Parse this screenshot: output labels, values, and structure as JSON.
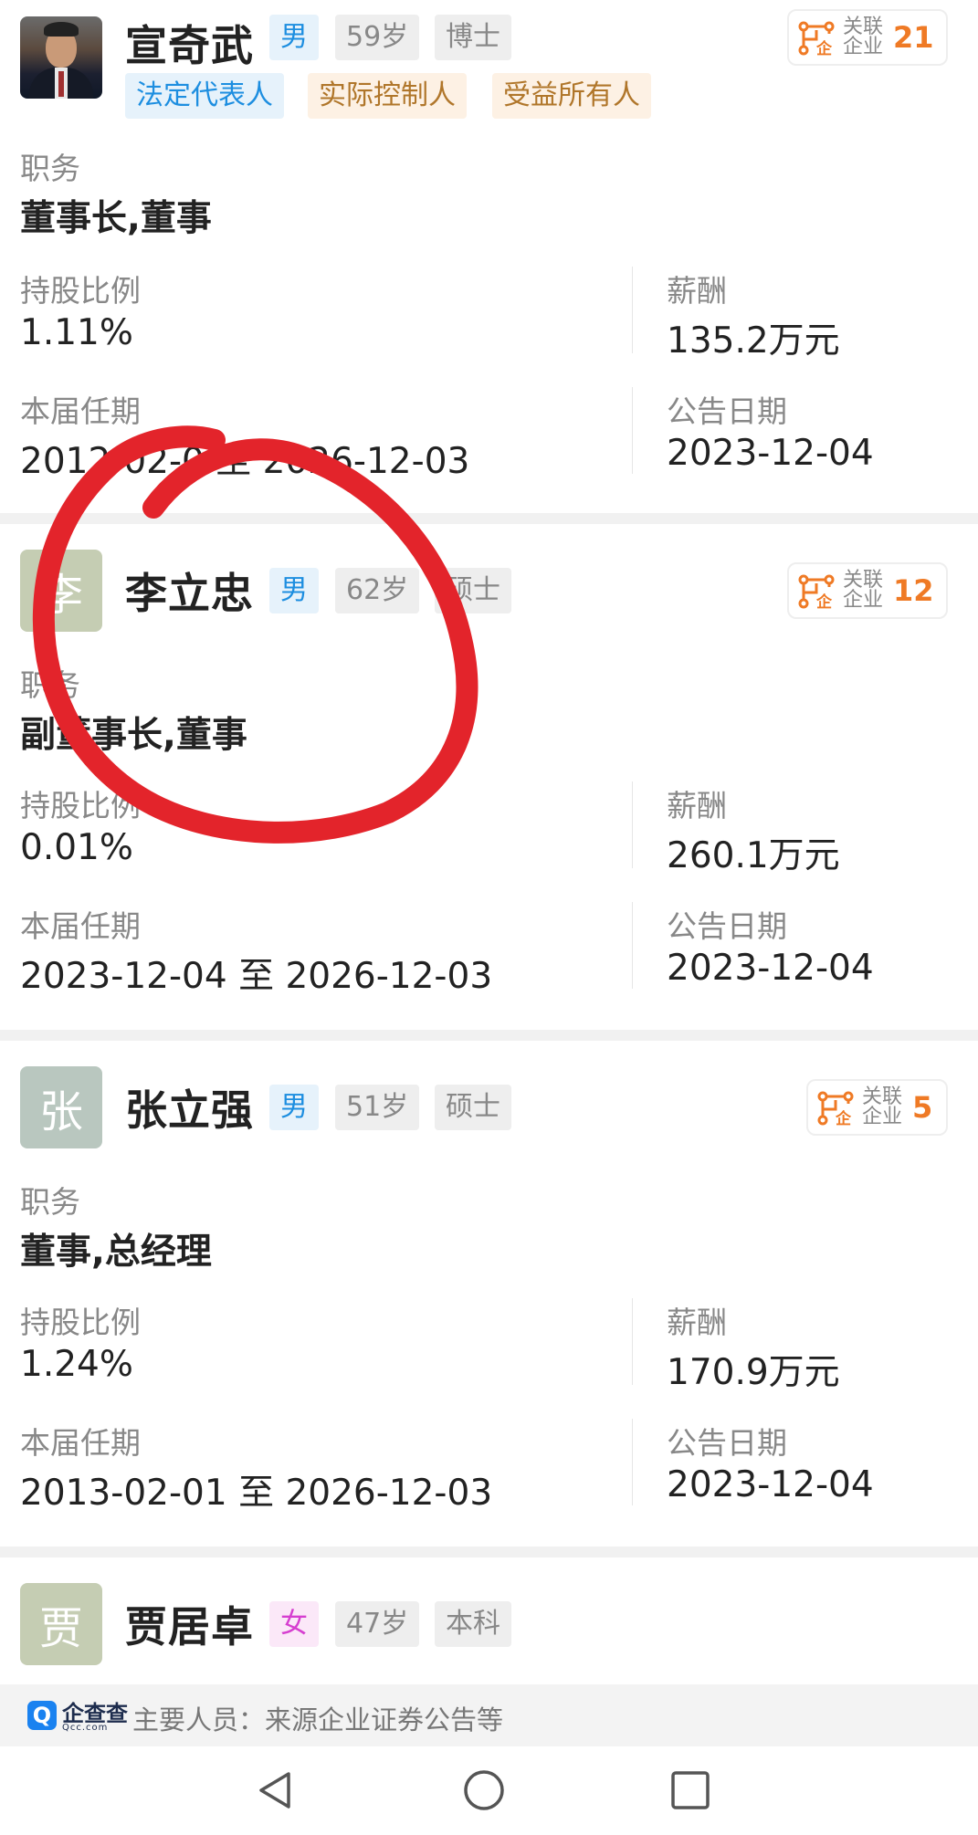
{
  "labels": {
    "position": "职务",
    "shareholding": "持股比例",
    "salary": "薪酬",
    "term": "本届任期",
    "announce": "公告日期",
    "term_sep": "至",
    "related_line1": "关联",
    "related_line2": "企业"
  },
  "people": [
    {
      "name": "宣奇武",
      "gender": "男",
      "age": "59岁",
      "education": "博士",
      "avatar_char": "",
      "roles": [
        "法定代表人",
        "实际控制人",
        "受益所有人"
      ],
      "related_count": "21",
      "position": "董事长,董事",
      "shareholding": "1.11%",
      "salary": "135.2万元",
      "term_start": "2012-02-0",
      "term_end": "2026-12-03",
      "announce_date": "2023-12-04"
    },
    {
      "name": "李立忠",
      "gender": "男",
      "age": "62岁",
      "education": "硕士",
      "avatar_char": "李",
      "related_count": "12",
      "position": "副董事长,董事",
      "shareholding": "0.01%",
      "salary": "260.1万元",
      "term_start": "2023-12-04",
      "term_end": "2026-12-03",
      "announce_date": "2023-12-04"
    },
    {
      "name": "张立强",
      "gender": "男",
      "age": "51岁",
      "education": "硕士",
      "avatar_char": "张",
      "related_count": "5",
      "position": "董事,总经理",
      "shareholding": "1.24%",
      "salary": "170.9万元",
      "term_start": "2013-02-01",
      "term_end": "2026-12-03",
      "announce_date": "2023-12-04"
    },
    {
      "name": "贾居卓",
      "gender": "女",
      "age": "47岁",
      "education": "本科",
      "avatar_char": "贾"
    }
  ],
  "footer": {
    "brand": "企查查",
    "brand_sub": "Qcc.com",
    "source_text": "主要人员：来源企业证券公告等"
  },
  "colors": {
    "accent_orange": "#ef7a25",
    "male_blue": "#1d8ee0",
    "female_pink": "#d63fd0",
    "annotation_red": "#e3242b",
    "avatar_green": "#b9c7bf",
    "avatar_green2": "#c5cdb3"
  },
  "icons": [
    "related-company-icon",
    "back-icon",
    "home-icon",
    "recents-icon",
    "qcc-logo-icon"
  ]
}
